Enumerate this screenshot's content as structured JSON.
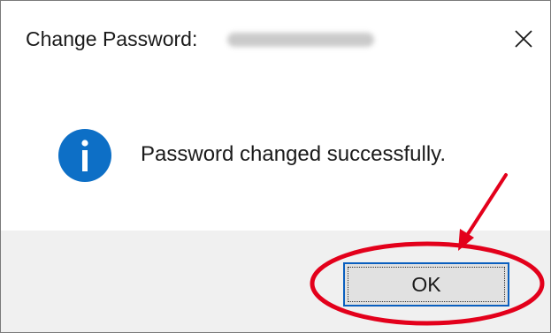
{
  "dialog": {
    "title": "Change Password:",
    "message": "Password changed successfully.",
    "ok_label": "OK"
  },
  "icons": {
    "close": "close-icon",
    "info": "info-icon"
  },
  "colors": {
    "info_blue": "#0d6fc6",
    "annotation_red": "#e3001b",
    "footer_bg": "#f0f0f0",
    "button_border": "#0a5fbf"
  }
}
